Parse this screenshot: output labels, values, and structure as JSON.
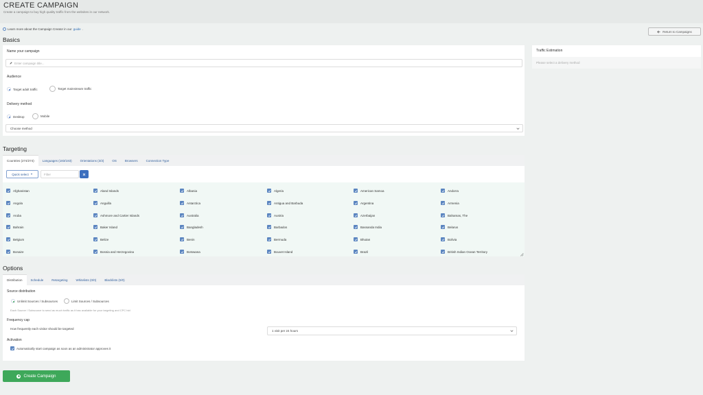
{
  "header": {
    "title": "CREATE CAMPAIGN",
    "subtitle": "Create a campaign to buy high quality traffic from the websites in our network."
  },
  "info": {
    "prefix": "Learn more about the Campaign Creator in our",
    "link": "guide",
    "suffix": "."
  },
  "return_button": "Return to Campaigns",
  "basics": {
    "title": "Basics",
    "name_label": "Name your campaign",
    "name_placeholder": "Enter campaign title...",
    "audience_label": "Audience",
    "audience_options": [
      "Target adult traffic",
      "Target mainstream traffic"
    ],
    "delivery_label": "Delivery method",
    "delivery_options": [
      "Desktop",
      "Mobile"
    ],
    "method_select": "Choose method"
  },
  "traffic": {
    "title": "Traffic Estimation",
    "message": "Please select a delivery method"
  },
  "targeting": {
    "title": "Targeting",
    "tabs": [
      "Countries (274/274)",
      "Languages (183/183)",
      "Orientations (3/3)",
      "OS",
      "Browsers",
      "Connection Type"
    ],
    "quick_select": "Quick select",
    "filter_placeholder": "Filter",
    "countries": [
      [
        "Afghanistan",
        "Aland Islands",
        "Albania",
        "Algeria",
        "American Samoa",
        "Andorra"
      ],
      [
        "Angola",
        "Anguilla",
        "Antarctica",
        "Antigua and Barbuda",
        "Argentina",
        "Armenia"
      ],
      [
        "Aruba",
        "Ashmore and Cartier Islands",
        "Australia",
        "Austria",
        "Azerbaijan",
        "Bahamas, The"
      ],
      [
        "Bahrain",
        "Baker Island",
        "Bangladesh",
        "Barbados",
        "Bassanda India",
        "Belarus"
      ],
      [
        "Belgium",
        "Belize",
        "Benin",
        "Bermuda",
        "Bhutan",
        "Bolivia"
      ],
      [
        "Bonaire",
        "Bosnia and Herzegovina",
        "Botswana",
        "Bouvet Island",
        "Brazil",
        "British Indian Ocean Territory"
      ]
    ]
  },
  "options": {
    "title": "Options",
    "tabs": [
      "Distribution",
      "Schedule",
      "Retargeting",
      "Whitelists (0/0)",
      "Blacklists (0/0)"
    ],
    "source_label": "Source distribution",
    "source_options": [
      "Unlimit Sources / Subsources",
      "Limit Sources / Subsources"
    ],
    "source_help": "Each Source / Subsource to send as much traffic as it has available for your targeting and CPC bid",
    "freq_label": "Frequency cap",
    "freq_help": "How frequently each visitor should be targeted",
    "freq_value": "1 visit per 24 hours",
    "activation_label": "Activation",
    "activation_text": "Automatically start campaign as soon as an administrator approves it"
  },
  "create_button": "Create Campaign",
  "colors": {
    "accent_blue": "#5b85c0",
    "green": "#3ea85a",
    "link": "#2f6eb5"
  }
}
